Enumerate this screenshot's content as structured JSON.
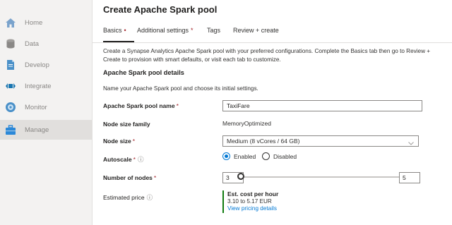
{
  "sidebar": {
    "items": [
      {
        "label": "Home",
        "icon": "home-icon",
        "color": "#7aa3cc"
      },
      {
        "label": "Data",
        "icon": "database-icon",
        "color": "#8a8886"
      },
      {
        "label": "Develop",
        "icon": "document-icon",
        "color": "#4a90c8"
      },
      {
        "label": "Integrate",
        "icon": "pipeline-icon",
        "color": "#1976b0"
      },
      {
        "label": "Monitor",
        "icon": "gauge-icon",
        "color": "#4a90c8"
      },
      {
        "label": "Manage",
        "icon": "toolbox-icon",
        "color": "#2b88d8"
      }
    ],
    "active_index": 5
  },
  "page": {
    "title": "Create Apache Spark pool",
    "tabs": [
      {
        "label": "Basics",
        "required": "•",
        "selected": true
      },
      {
        "label": "Additional settings",
        "required": "*",
        "selected": false
      },
      {
        "label": "Tags",
        "required": "",
        "selected": false
      },
      {
        "label": "Review + create",
        "required": "",
        "selected": false
      }
    ],
    "description": "Create a Synapse Analytics Apache Spark pool with your preferred configurations. Complete the Basics tab then go to Review + Create to provision with smart defaults, or visit each tab to customize.",
    "section_title": "Apache Spark pool details",
    "section_subtitle": "Name your Apache Spark pool and choose its initial settings."
  },
  "form": {
    "pool_name": {
      "label": "Apache Spark pool name",
      "required": "*",
      "value": "TaxiFare"
    },
    "node_size_family": {
      "label": "Node size family",
      "value": "MemoryOptimized"
    },
    "node_size": {
      "label": "Node size",
      "required": "*",
      "value": "Medium (8 vCores / 64 GB)"
    },
    "autoscale": {
      "label": "Autoscale",
      "required": "*",
      "info": "ⓘ",
      "options": [
        "Enabled",
        "Disabled"
      ],
      "selected": "Enabled"
    },
    "nodes": {
      "label": "Number of nodes",
      "required": "*",
      "min_value": "3",
      "max_value": "5",
      "min_fraction": 0.0,
      "max_fraction": 1.0
    },
    "estimated_price": {
      "label": "Estimated price",
      "info": "ⓘ",
      "title": "Est. cost per hour",
      "range": "3.10 to 5.17 EUR",
      "link": "View pricing details"
    }
  },
  "colors": {
    "accent": "#0078d4",
    "required": "#a4262c",
    "price_bar": "#107c10"
  }
}
